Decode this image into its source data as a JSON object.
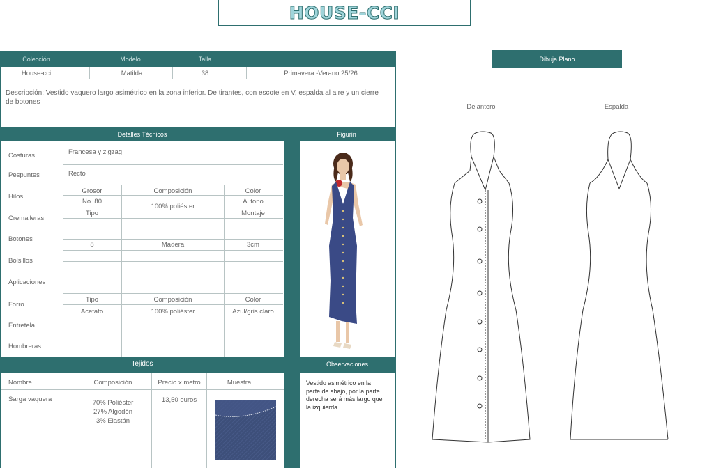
{
  "title": "HOUSE-CCI",
  "header": {
    "labels": [
      "Colección",
      "Modelo",
      "Talla"
    ],
    "values": [
      "House-cci",
      "Matilda",
      "38",
      "Primavera -Verano 25/26"
    ]
  },
  "description": "Descripción: Vestido vaquero largo asimétrico en la zona inferior. De tirantes, con escote en V, espalda al aire y un cierre de botones",
  "technical": {
    "title": "Detalles Técnicos",
    "rows": [
      "Costuras",
      "Pespuntes",
      "Hilos",
      "Cremalleras",
      "Botones",
      "Bolsillos",
      "Aplicaciones",
      "Forro",
      "Entretela",
      "Hombreras"
    ],
    "costuras_value": "Francesa y zigzag",
    "pespuntes_value": "Recto",
    "thread_headers": [
      "Grosor",
      "Composición",
      "Color"
    ],
    "thread_grosor": "No. 80",
    "thread_tipo": "Tipo",
    "thread_composicion": "100% poliéster",
    "thread_color": "Al tono",
    "thread_montaje": "Montaje",
    "buttons": [
      "8",
      "Madera",
      "3cm"
    ],
    "lining_headers": [
      "Tipo",
      "Composición",
      "Color"
    ],
    "lining_values": [
      "Acetato",
      "100% poliéster",
      "Azul/gris claro"
    ]
  },
  "figurin": {
    "title": "Figurin",
    "colors": {
      "dress": "#3a4a86",
      "skin": "#e9c7a8",
      "hair": "#4a2a1a",
      "flower": "#c0282c"
    }
  },
  "fabrics": {
    "title": "Tejidos",
    "headers": [
      "Nombre",
      "Composición",
      "Precio x metro",
      "Muestra"
    ],
    "name": "Sarga vaquera",
    "composition": [
      "70% Poliéster",
      "27% Algodón",
      "3% Elastán"
    ],
    "price": "13,50 euros",
    "swatch_color": "#3d4f7a"
  },
  "observations": {
    "title": "Observaciones",
    "lines": [
      "Vestido asimétrico en la",
      "parte de abajo, por la parte",
      "derecha será más largo que",
      "la izquierda."
    ]
  },
  "flat": {
    "title": "Dibuja Plano",
    "front_label": "Delantero",
    "back_label": "Espalda"
  },
  "colors": {
    "accent": "#2e6f6f"
  }
}
